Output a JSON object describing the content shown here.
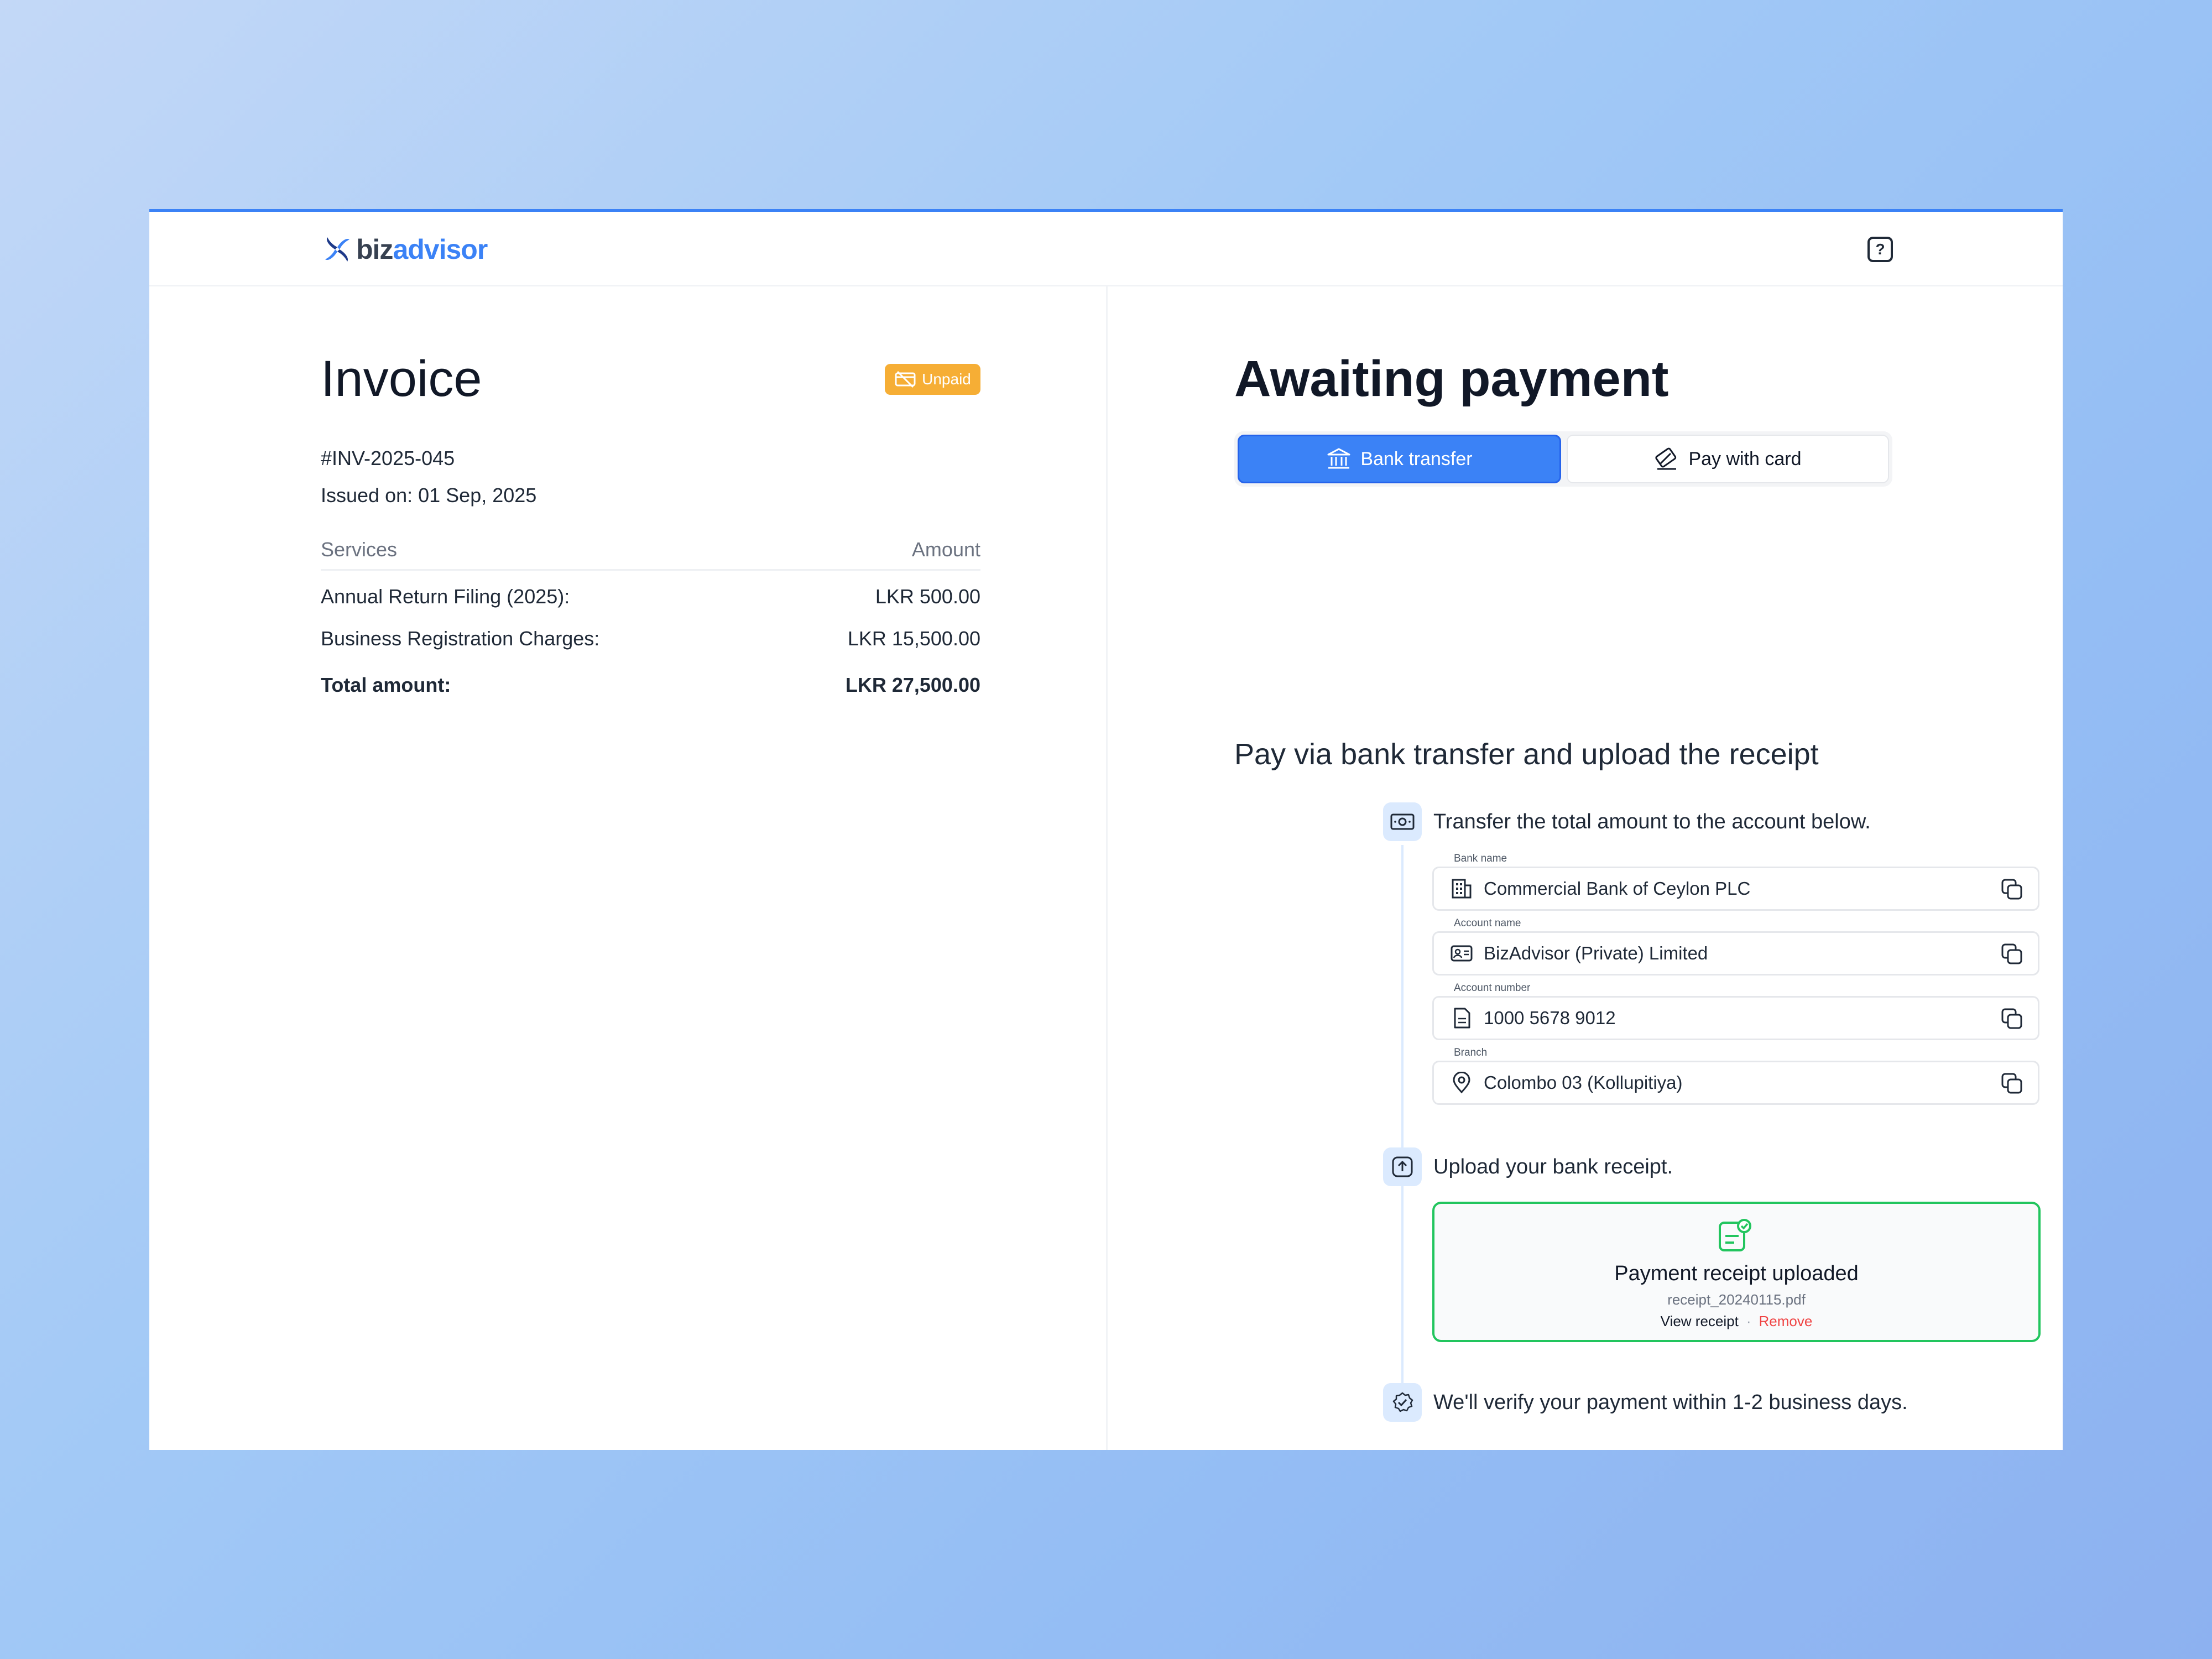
{
  "app": {
    "logo_biz": "biz",
    "logo_advisor": "advisor",
    "help_label": "?"
  },
  "invoice": {
    "title": "Invoice",
    "status": "Unpaid",
    "number": "#INV-2025-045",
    "issued": "Issued on: 01 Sep, 2025",
    "services_header": "Services",
    "amount_header": "Amount",
    "items": [
      {
        "name": "Annual Return Filing (2025):",
        "amount": "LKR 500.00"
      },
      {
        "name": "Business Registration Charges:",
        "amount": "LKR 15,500.00"
      }
    ],
    "total_label": "Total amount:",
    "total_amount": "LKR 27,500.00"
  },
  "payment": {
    "title": "Awaiting payment",
    "tabs": [
      {
        "label": "Bank transfer",
        "active": true
      },
      {
        "label": "Pay with card",
        "active": false
      }
    ],
    "heading": "Pay via bank transfer and upload the receipt",
    "steps": [
      {
        "text": "Transfer the total amount to the account below.",
        "icon": "cash-icon"
      },
      {
        "text": "Upload your bank receipt.",
        "icon": "upload-icon"
      },
      {
        "text": "We'll verify your payment within 1-2 business days.",
        "icon": "verified-badge-icon"
      }
    ],
    "fields": [
      {
        "label": "Bank name",
        "value": "Commercial Bank of Ceylon PLC",
        "icon": "building-icon"
      },
      {
        "label": "Account name",
        "value": "BizAdvisor (Private) Limited",
        "icon": "id-card-icon"
      },
      {
        "label": "Account number",
        "value": "1000 5678 9012",
        "icon": "document-icon"
      },
      {
        "label": "Branch",
        "value": "Colombo 03 (Kollupitiya)",
        "icon": "location-pin-icon"
      }
    ],
    "upload": {
      "title": "Payment receipt uploaded",
      "filename": "receipt_20240115.pdf",
      "view_label": "View receipt",
      "separator": "·",
      "remove_label": "Remove"
    }
  },
  "colors": {
    "accent": "#3b82f6",
    "unpaid": "#f6ae35",
    "success": "#22c55e",
    "danger": "#ef4444"
  }
}
